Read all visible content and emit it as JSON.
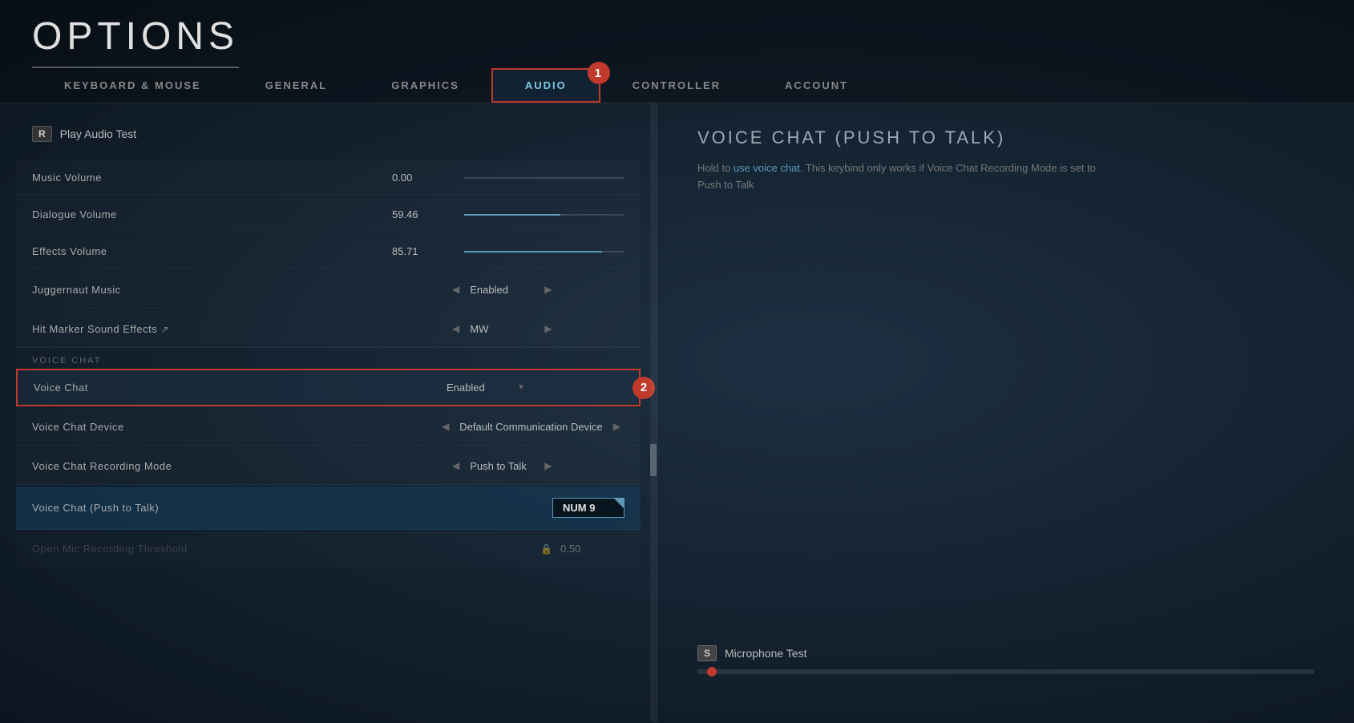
{
  "page": {
    "title": "OPTIONS"
  },
  "nav": {
    "tabs": [
      {
        "id": "keyboard-mouse",
        "label": "KEYBOARD & MOUSE",
        "active": false
      },
      {
        "id": "general",
        "label": "GENERAL",
        "active": false
      },
      {
        "id": "graphics",
        "label": "GRAPHICS",
        "active": false
      },
      {
        "id": "audio",
        "label": "AUDIO",
        "active": true
      },
      {
        "id": "controller",
        "label": "CONTROLLER",
        "active": false
      },
      {
        "id": "account",
        "label": "ACCOUNT",
        "active": false
      }
    ]
  },
  "left_panel": {
    "play_audio_test_key": "R",
    "play_audio_test_label": "Play Audio Test",
    "settings": [
      {
        "id": "music-volume",
        "label": "Music Volume",
        "value": "0.00",
        "type": "slider",
        "fill_pct": 0
      },
      {
        "id": "dialogue-volume",
        "label": "Dialogue Volume",
        "value": "59.46",
        "type": "slider",
        "fill_pct": 60
      },
      {
        "id": "effects-volume",
        "label": "Effects Volume",
        "value": "85.71",
        "type": "slider",
        "fill_pct": 86
      },
      {
        "id": "juggernaut-music",
        "label": "Juggernaut Music",
        "value": "Enabled",
        "type": "dropdown"
      },
      {
        "id": "hit-marker-sound",
        "label": "Hit Marker Sound Effects",
        "value": "MW",
        "type": "dropdown",
        "has_external": true
      }
    ],
    "section_label": "Voice Chat",
    "voice_chat_settings": [
      {
        "id": "voice-chat",
        "label": "Voice Chat",
        "value": "Enabled",
        "type": "dropdown-highlight",
        "highlighted": true
      },
      {
        "id": "voice-chat-device",
        "label": "Voice Chat Device",
        "value": "Default Communication Device",
        "type": "dropdown"
      },
      {
        "id": "voice-chat-recording-mode",
        "label": "Voice Chat Recording Mode",
        "value": "Push to Talk",
        "type": "dropdown"
      },
      {
        "id": "voice-chat-push-to-talk",
        "label": "Voice Chat (Push to Talk)",
        "value": "NUM 9",
        "type": "keybind",
        "highlighted_blue": true
      },
      {
        "id": "open-mic-threshold",
        "label": "Open Mic Recording Threshold",
        "value": "0.50",
        "type": "locked",
        "dimmed": true
      }
    ]
  },
  "right_panel": {
    "help_title": "VOICE CHAT (PUSH TO TALK)",
    "help_text_before_link": "Hold to ",
    "help_link_text": "use voice chat",
    "help_text_after_link": ". This keybind only works if Voice Chat Recording Mode is set to Push to Talk",
    "mic_test": {
      "key": "S",
      "label": "Microphone Test"
    }
  },
  "badges": {
    "badge1": "1",
    "badge2": "2"
  }
}
